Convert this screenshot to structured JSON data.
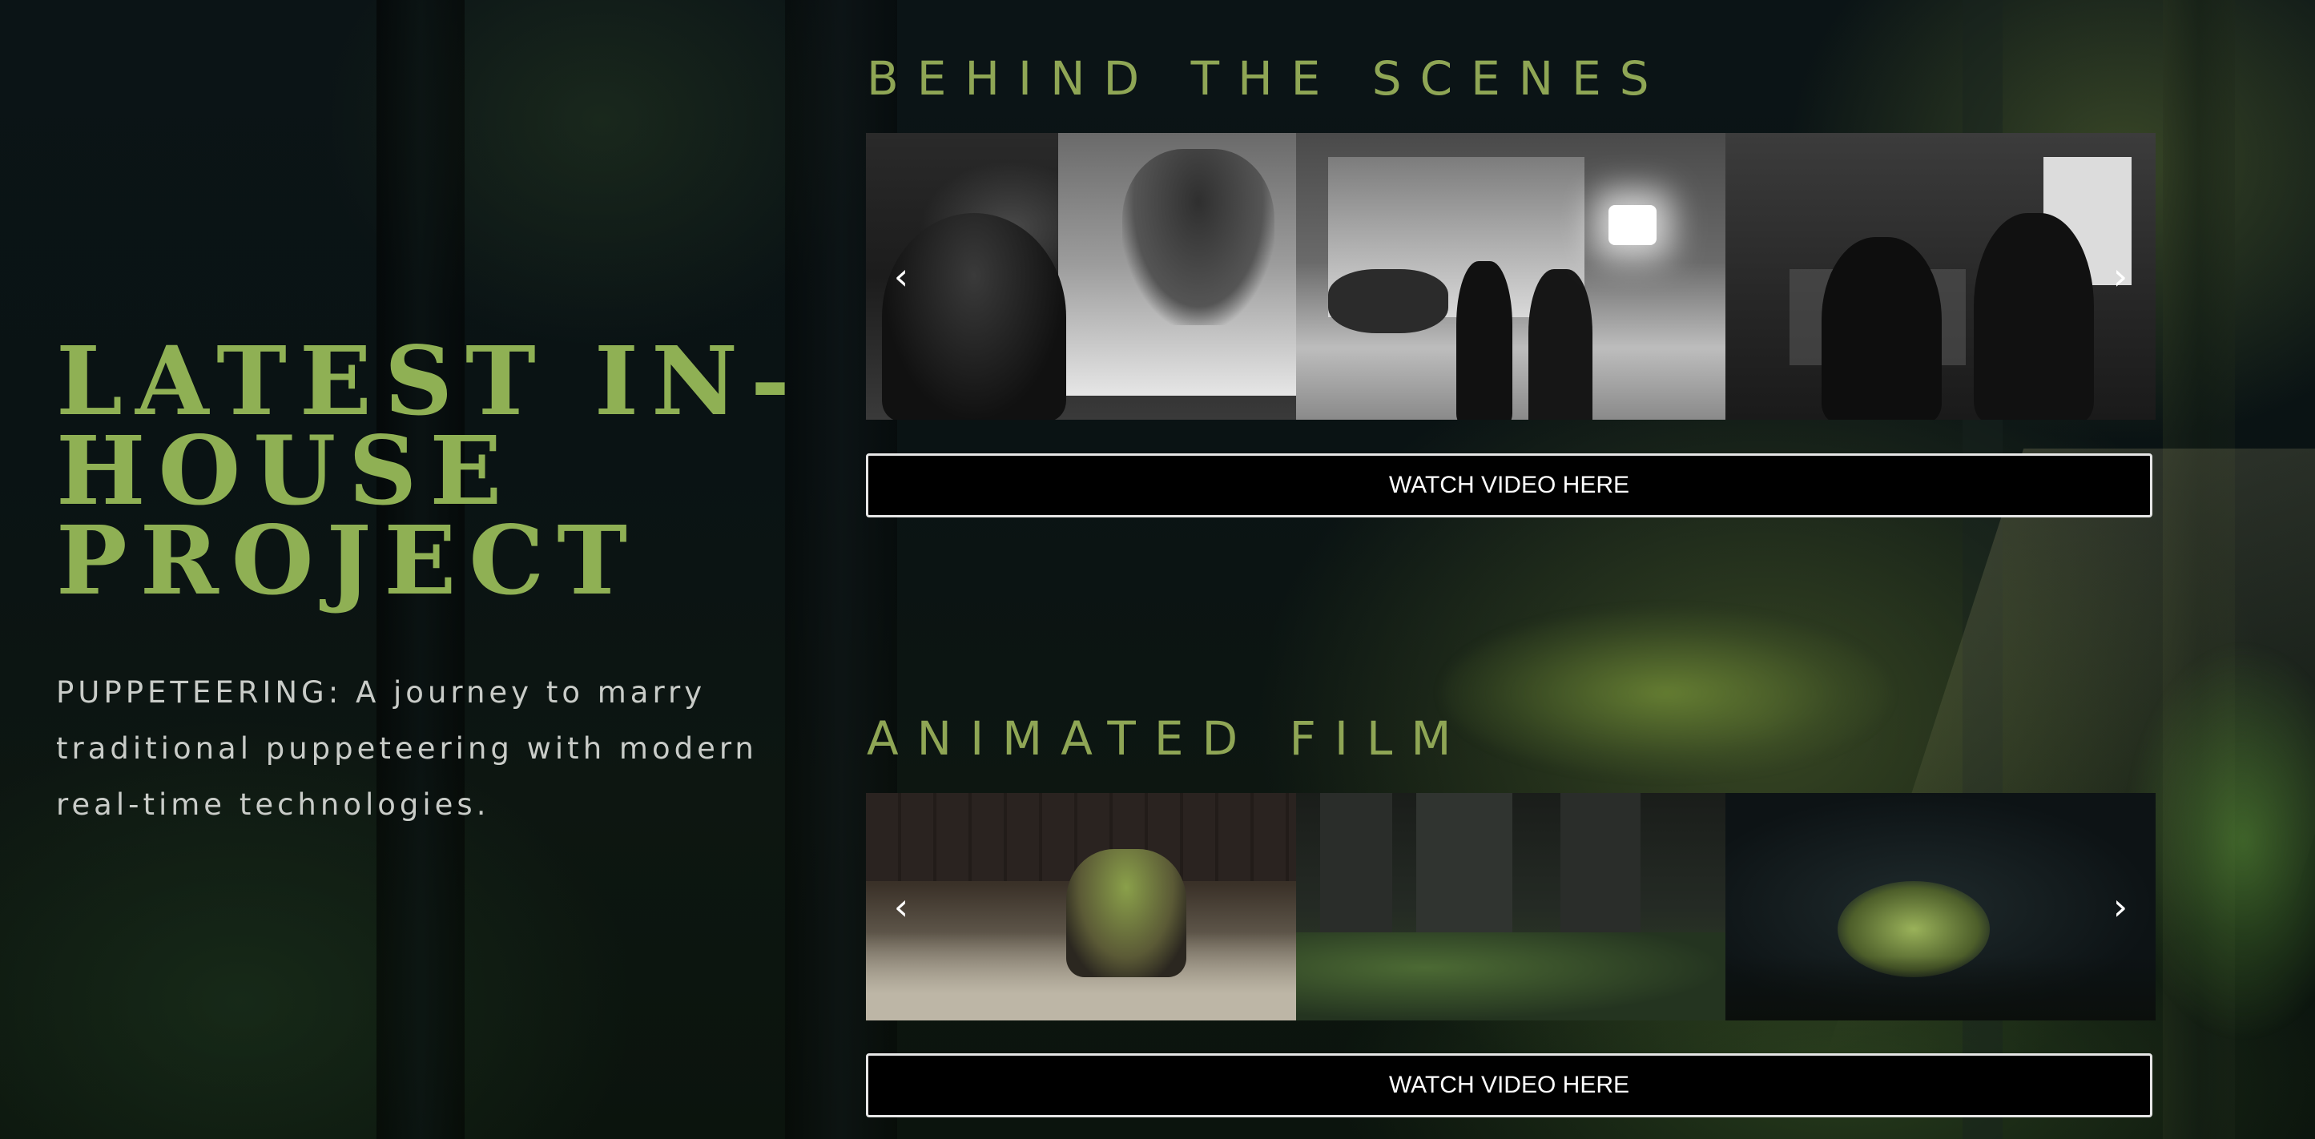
{
  "hero": {
    "title": "LATEST IN-HOUSE PROJECT",
    "description": "PUPPETEERING: A journey to marry traditional puppeteering with modern real-time technologies."
  },
  "sections": [
    {
      "title": "BEHIND THE SCENES",
      "button_label": "WATCH VIDEO HERE",
      "slides": [
        "studio-puppeteer-screen",
        "stage-lighting-crew",
        "control-room-operators"
      ]
    },
    {
      "title": "ANIMATED FILM",
      "button_label": "WATCH VIDEO HERE",
      "slides": [
        "robot-dog-rubble",
        "overgrown-city-ruins",
        "robot-in-forest"
      ]
    }
  ],
  "icons": {
    "prev": "chevron-left-icon",
    "next": "chevron-right-icon",
    "prev_glyph": "‹",
    "next_glyph": "›"
  },
  "colors": {
    "accent_green": "#8fb054",
    "section_title": "#8fa655",
    "button_bg": "#000000",
    "button_border": "#e6e6e6",
    "text_light": "#c9ccc8"
  }
}
